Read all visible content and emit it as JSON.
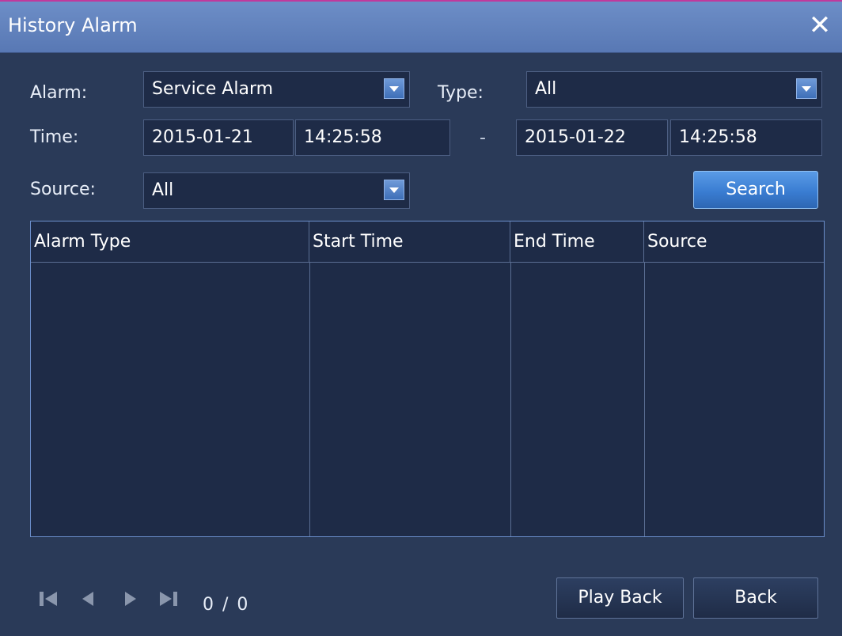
{
  "window": {
    "title": "History Alarm"
  },
  "filters": {
    "alarm_label": "Alarm:",
    "alarm_value": "Service Alarm",
    "type_label": "Type:",
    "type_value": "All",
    "time_label": "Time:",
    "start_date": "2015-01-21",
    "start_time": "14:25:58",
    "separator": "-",
    "end_date": "2015-01-22",
    "end_time": "14:25:58",
    "source_label": "Source:",
    "source_value": "All",
    "search_label": "Search"
  },
  "table": {
    "columns": [
      "Alarm Type",
      "Start Time",
      "End Time",
      "Source"
    ],
    "rows": []
  },
  "pager": {
    "current": "0",
    "total": "0",
    "display": "0 / 0"
  },
  "buttons": {
    "play_back": "Play Back",
    "back": "Back"
  },
  "icons": {
    "close": "close-icon",
    "first": "first-page-icon",
    "prev": "prev-page-icon",
    "next": "next-page-icon",
    "last": "last-page-icon"
  },
  "colors": {
    "titlebar": "#5f80bb",
    "background": "#2a3a58",
    "field": "#1e2b47",
    "accent": "#3a7dd2"
  }
}
